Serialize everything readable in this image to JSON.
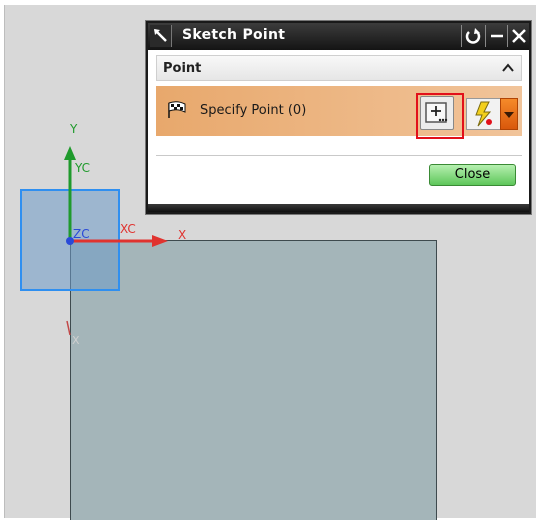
{
  "dialog": {
    "title": "Sketch Point",
    "group_title": "Point",
    "specify_point_label": "Specify Point (0)",
    "close_label": "Close"
  },
  "axes": {
    "y_label": "Y",
    "yc_label": "YC",
    "zc_label": "ZC",
    "xc_label": "XC",
    "x_label": "X"
  },
  "icons": {
    "title": "sketch-pencil-icon",
    "reset": "reset-icon",
    "minimize": "minimize-icon",
    "close": "close-icon",
    "collapse": "chevron-up-icon",
    "flag": "checkered-flag-icon",
    "point_dialog": "point-dialog-icon",
    "inferred_point": "lightning-point-icon",
    "dropdown": "dropdown-arrow-icon"
  },
  "colors": {
    "highlight": "#e2101a",
    "plane": "#a4b5b9",
    "selection": "#2f8ff0",
    "x_axis": "#e0332f",
    "y_axis": "#1f9a2c",
    "z_axis": "#2a4ad8",
    "close_button": "#5ec65a"
  }
}
